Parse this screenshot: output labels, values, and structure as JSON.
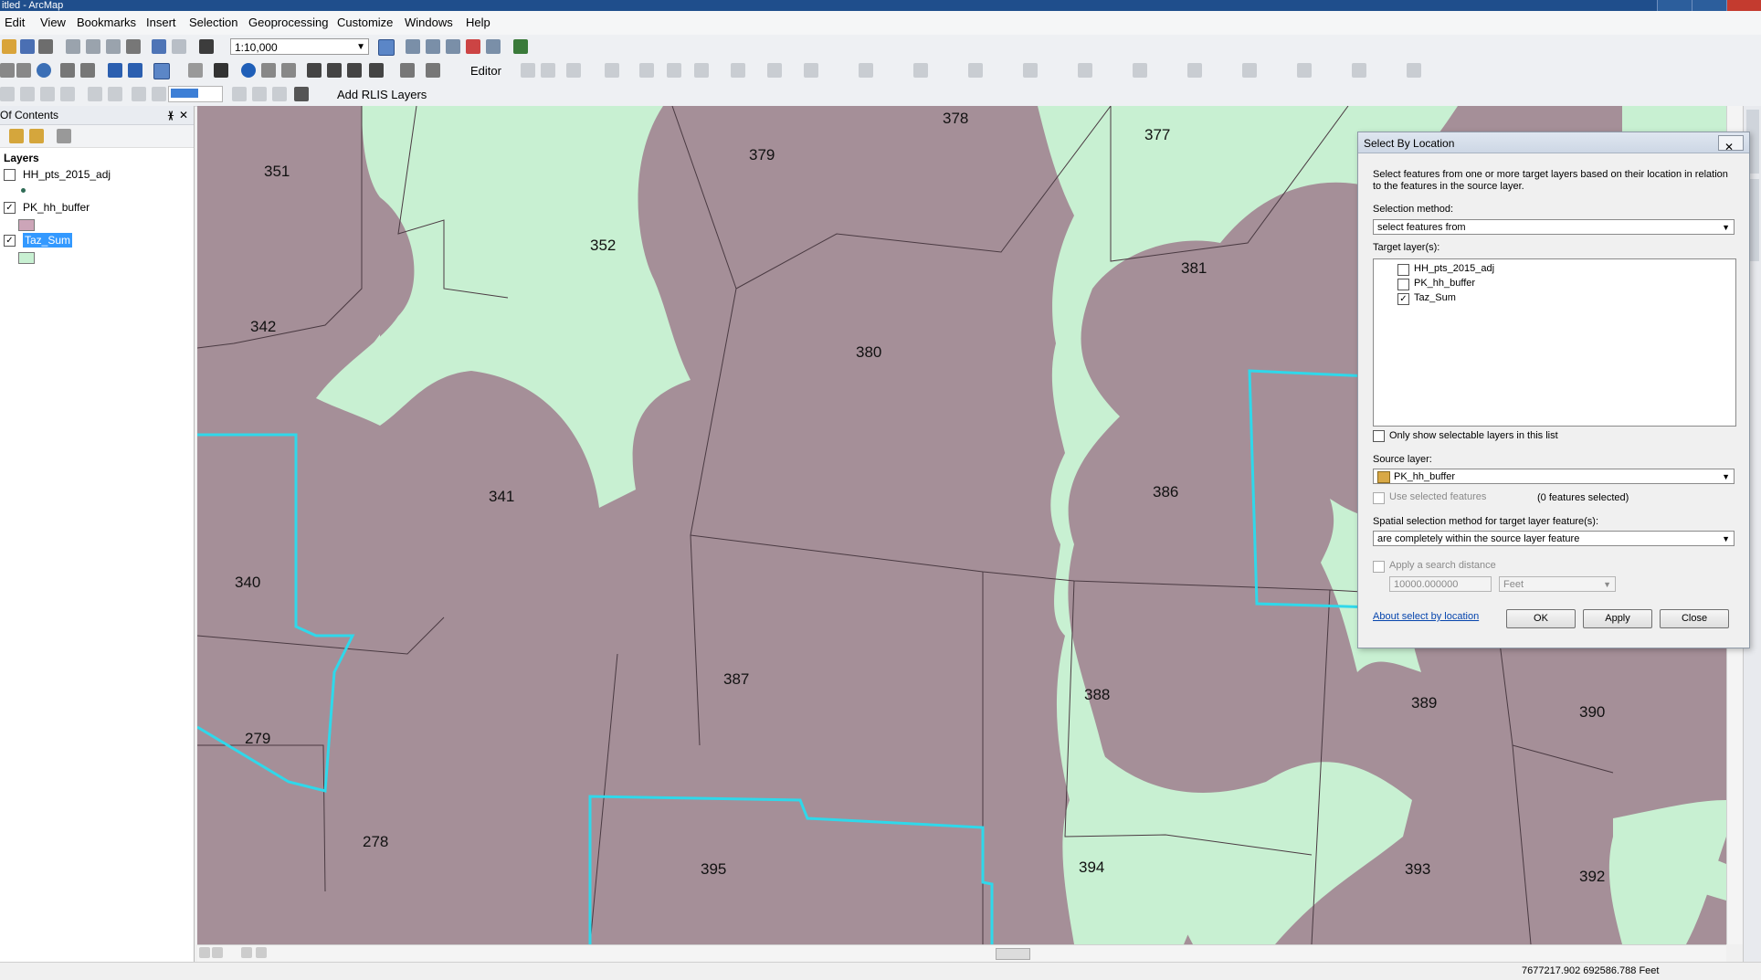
{
  "window": {
    "title": "itled - ArcMap"
  },
  "menu": [
    "Edit",
    "View",
    "Bookmarks",
    "Insert",
    "Selection",
    "Geoprocessing",
    "Customize",
    "Windows",
    "Help"
  ],
  "toolbar": {
    "scale": "1:10,000",
    "editor_label": "Editor",
    "add_rlis_label": "Add RLIS Layers"
  },
  "toc": {
    "header": "Of Contents",
    "group": "Layers",
    "layers": [
      {
        "name": "HH_pts_2015_adj",
        "checked": false
      },
      {
        "name": "PK_hh_buffer",
        "checked": true,
        "color": "#a58f98"
      },
      {
        "name": "Taz_Sum",
        "checked": true,
        "color": "#c8f0d2",
        "selected": true
      }
    ]
  },
  "map": {
    "colors": {
      "buffer": "#a58f98",
      "taz": "#c8f0d2",
      "highlight": "#2fd8ea",
      "boundary": "#4a3a42"
    },
    "labels": [
      "351",
      "379",
      "378",
      "377",
      "352",
      "381",
      "342",
      "380",
      "341",
      "386",
      "340",
      "387",
      "388",
      "389",
      "390",
      "279",
      "278",
      "395",
      "394",
      "393",
      "392"
    ]
  },
  "dialog": {
    "title": "Select By Location",
    "close_glyph": "✕",
    "description": "Select features from one or more target layers based on their location in relation to the features in the source layer.",
    "selection_method_label": "Selection method:",
    "selection_method_value": "select features from",
    "target_layers_label": "Target layer(s):",
    "target_layers": [
      {
        "name": "HH_pts_2015_adj",
        "checked": false
      },
      {
        "name": "PK_hh_buffer",
        "checked": false
      },
      {
        "name": "Taz_Sum",
        "checked": true
      }
    ],
    "only_selectable_label": "Only show selectable layers in this list",
    "source_layer_label": "Source layer:",
    "source_layer_value": "PK_hh_buffer",
    "use_selected_label": "Use selected features",
    "features_selected": "(0 features selected)",
    "spatial_method_label": "Spatial selection method for target layer feature(s):",
    "spatial_method_value": "are completely within the source layer feature",
    "search_distance_label": "Apply a search distance",
    "search_distance_value": "10000.000000",
    "distance_unit": "Feet",
    "about_link": "About select by location",
    "buttons": {
      "ok": "OK",
      "apply": "Apply",
      "close": "Close"
    }
  },
  "status": {
    "coordinates": "7677217.902  692586.788 Feet"
  }
}
